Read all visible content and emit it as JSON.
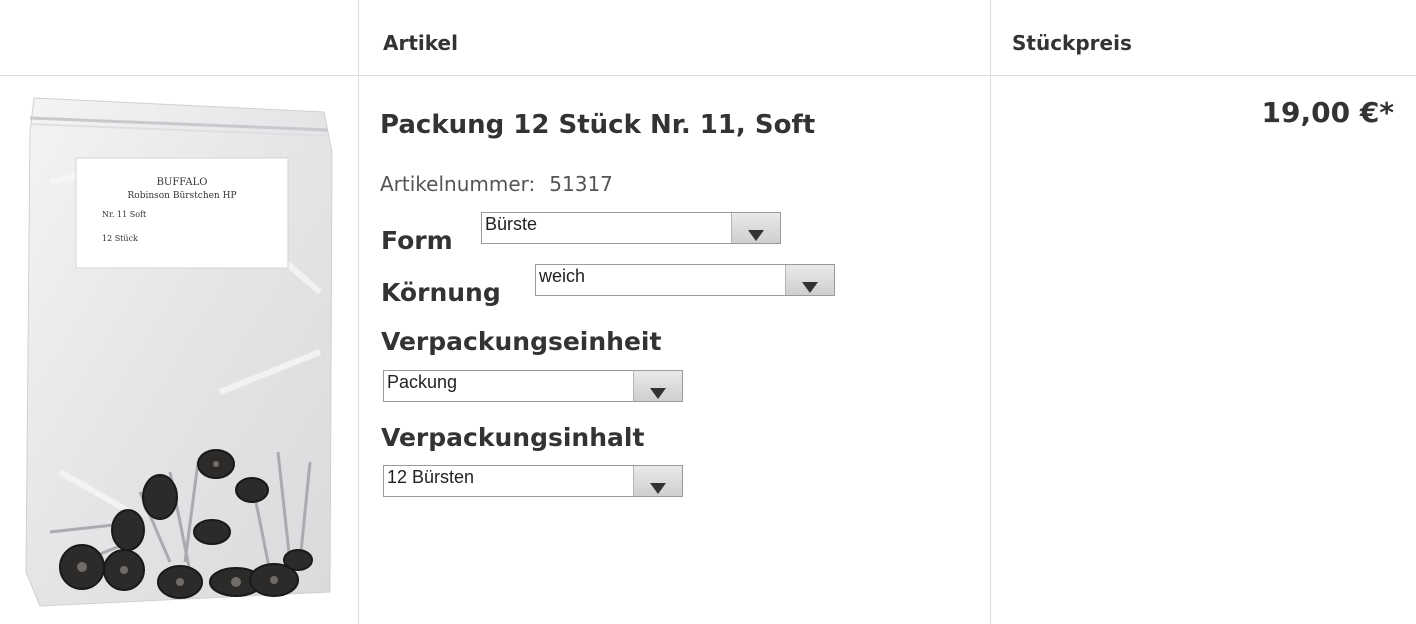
{
  "table": {
    "header": {
      "article_label": "Artikel",
      "price_label": "Stückpreis"
    }
  },
  "product": {
    "title": "Packung 12 Stück Nr. 11, Soft",
    "article_number_label": "Artikelnummer:",
    "article_number": "51317",
    "price": "19,00 €*",
    "image": {
      "label_lines": [
        "BUFFALO",
        "Robinson Bürstchen HP",
        "Nr. 11 Soft",
        "12 Stück"
      ],
      "icon": "product-bag-image"
    },
    "options": [
      {
        "label": "Form",
        "selected": "Bürste"
      },
      {
        "label": "Körnung",
        "selected": "weich"
      },
      {
        "label": "Verpackungseinheit",
        "selected": "Packung"
      },
      {
        "label": "Verpackungsinhalt",
        "selected": "12 Bürsten"
      }
    ]
  },
  "colors": {
    "border": "#dadde2",
    "text": "#333333"
  }
}
